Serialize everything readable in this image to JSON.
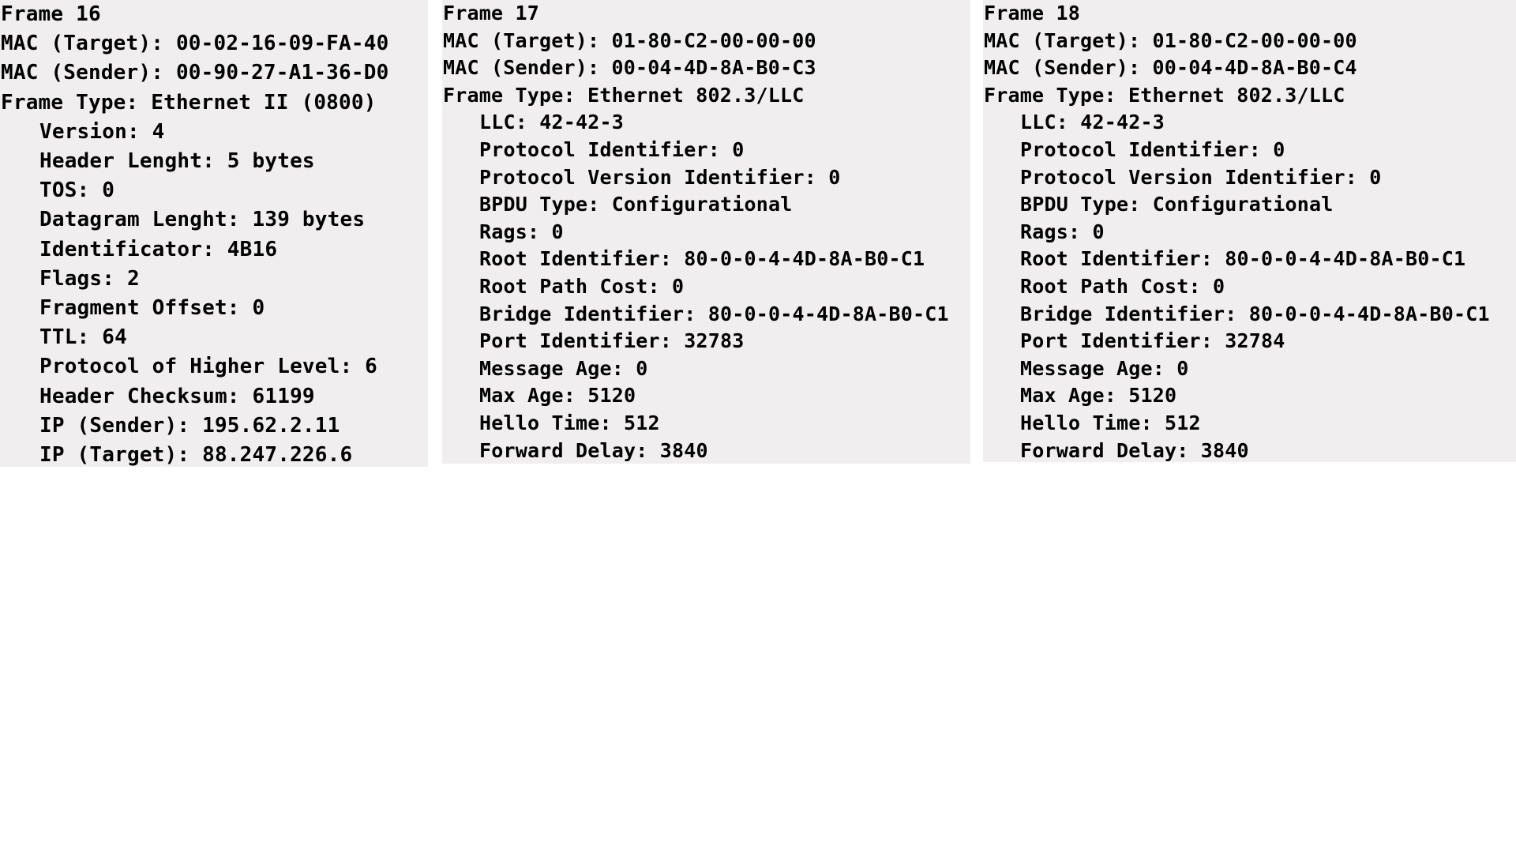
{
  "frames": [
    {
      "title": "Frame 16",
      "mac_target": "MAC (Target): 00-02-16-09-FA-40",
      "mac_sender": "MAC (Sender): 00-90-27-A1-36-D0",
      "frame_type": "Frame Type: Ethernet II (0800)",
      "fields": [
        "Version: 4",
        "Header Lenght: 5 bytes",
        "TOS: 0",
        "Datagram Lenght: 139 bytes",
        "Identificator: 4B16",
        "Flags: 2",
        "Fragment Offset: 0",
        "TTL: 64",
        "Protocol of Higher Level: 6",
        "Header Checksum: 61199",
        "IP (Sender): 195.62.2.11",
        "IP (Target): 88.247.226.6"
      ]
    },
    {
      "title": "Frame 17",
      "mac_target": "MAC (Target): 01-80-C2-00-00-00",
      "mac_sender": "MAC (Sender): 00-04-4D-8A-B0-C3",
      "frame_type": "Frame Type: Ethernet 802.3/LLC",
      "fields": [
        "LLC: 42-42-3",
        "Protocol Identifier: 0",
        "Protocol Version Identifier: 0",
        "BPDU Type: Configurational",
        "Rags: 0",
        "Root Identifier: 80-0-0-4-4D-8A-B0-C1",
        "Root Path Cost: 0",
        "Bridge Identifier: 80-0-0-4-4D-8A-B0-C1",
        "Port Identifier: 32783",
        "Message Age: 0",
        "Max Age: 5120",
        "Hello Time: 512",
        "Forward Delay: 3840"
      ]
    },
    {
      "title": "Frame 18",
      "mac_target": "MAC (Target): 01-80-C2-00-00-00",
      "mac_sender": "MAC (Sender): 00-04-4D-8A-B0-C4",
      "frame_type": "Frame Type: Ethernet 802.3/LLC",
      "fields": [
        "LLC: 42-42-3",
        "Protocol Identifier: 0",
        "Protocol Version Identifier: 0",
        "BPDU Type: Configurational",
        "Rags: 0",
        "Root Identifier: 80-0-0-4-4D-8A-B0-C1",
        "Root Path Cost: 0",
        "Bridge Identifier: 80-0-0-4-4D-8A-B0-C1",
        "Port Identifier: 32784",
        "Message Age: 0",
        "Max Age: 5120",
        "Hello Time: 512",
        "Forward Delay: 3840"
      ]
    }
  ]
}
